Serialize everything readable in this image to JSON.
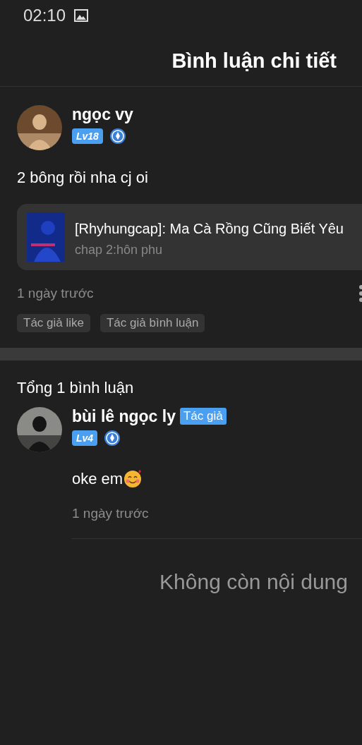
{
  "status_bar": {
    "time": "02:10"
  },
  "header": {
    "title": "Bình luận chi tiết"
  },
  "comment": {
    "user": {
      "name": "ngọc vy",
      "level": "Lv18"
    },
    "text": "2 bông rồi nha cj oi",
    "story": {
      "title": "[Rhyhungcap]: Ma Cà Rồng Cũng Biết Yêu",
      "chapter": "chap 2:hôn phu"
    },
    "time": "1 ngày trước",
    "tags": [
      "Tác giả like",
      "Tác giả bình luận"
    ]
  },
  "replies_heading": "Tổng 1 bình luận",
  "replies": [
    {
      "user": {
        "name": "bùi lê ngọc ly",
        "role": "Tác giả",
        "level": "Lv4"
      },
      "text": "oke em",
      "time": "1 ngày trước"
    }
  ],
  "end_message": "Không còn nội dung"
}
